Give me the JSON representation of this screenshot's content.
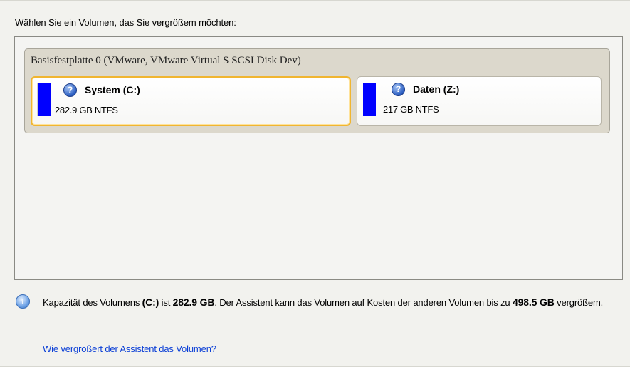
{
  "instruction": "Wählen Sie ein Volumen, das Sie vergrößem möchten:",
  "disk": {
    "name": "Basisfestplatte 0 (VMware, VMware Virtual S SCSI Disk Dev)",
    "volumes": [
      {
        "label": "System (C:)",
        "size": "282.9 GB NTFS",
        "selected": true,
        "bar_color": "#0000ff"
      },
      {
        "label": "Daten (Z:)",
        "size": "217 GB NTFS",
        "selected": false,
        "bar_color": "#0000ff"
      }
    ]
  },
  "info": {
    "part1": "Kapazität des Volumens ",
    "volume": "(C:)",
    "part2": " ist ",
    "capacity": "282.9 GB",
    "part3": ". Der Assistent kann das Volumen auf Kosten der anderen Volumen bis zu ",
    "max": "498.5 GB",
    "part4": " vergrößem."
  },
  "help_link": "Wie vergrößert der Assistent das Volumen?",
  "colors": {
    "selection_border": "#f0b530",
    "volume_bar": "#0000ff",
    "link": "#0b3fd6"
  },
  "icons": {
    "volume_help": "question-icon",
    "info": "info-icon"
  }
}
